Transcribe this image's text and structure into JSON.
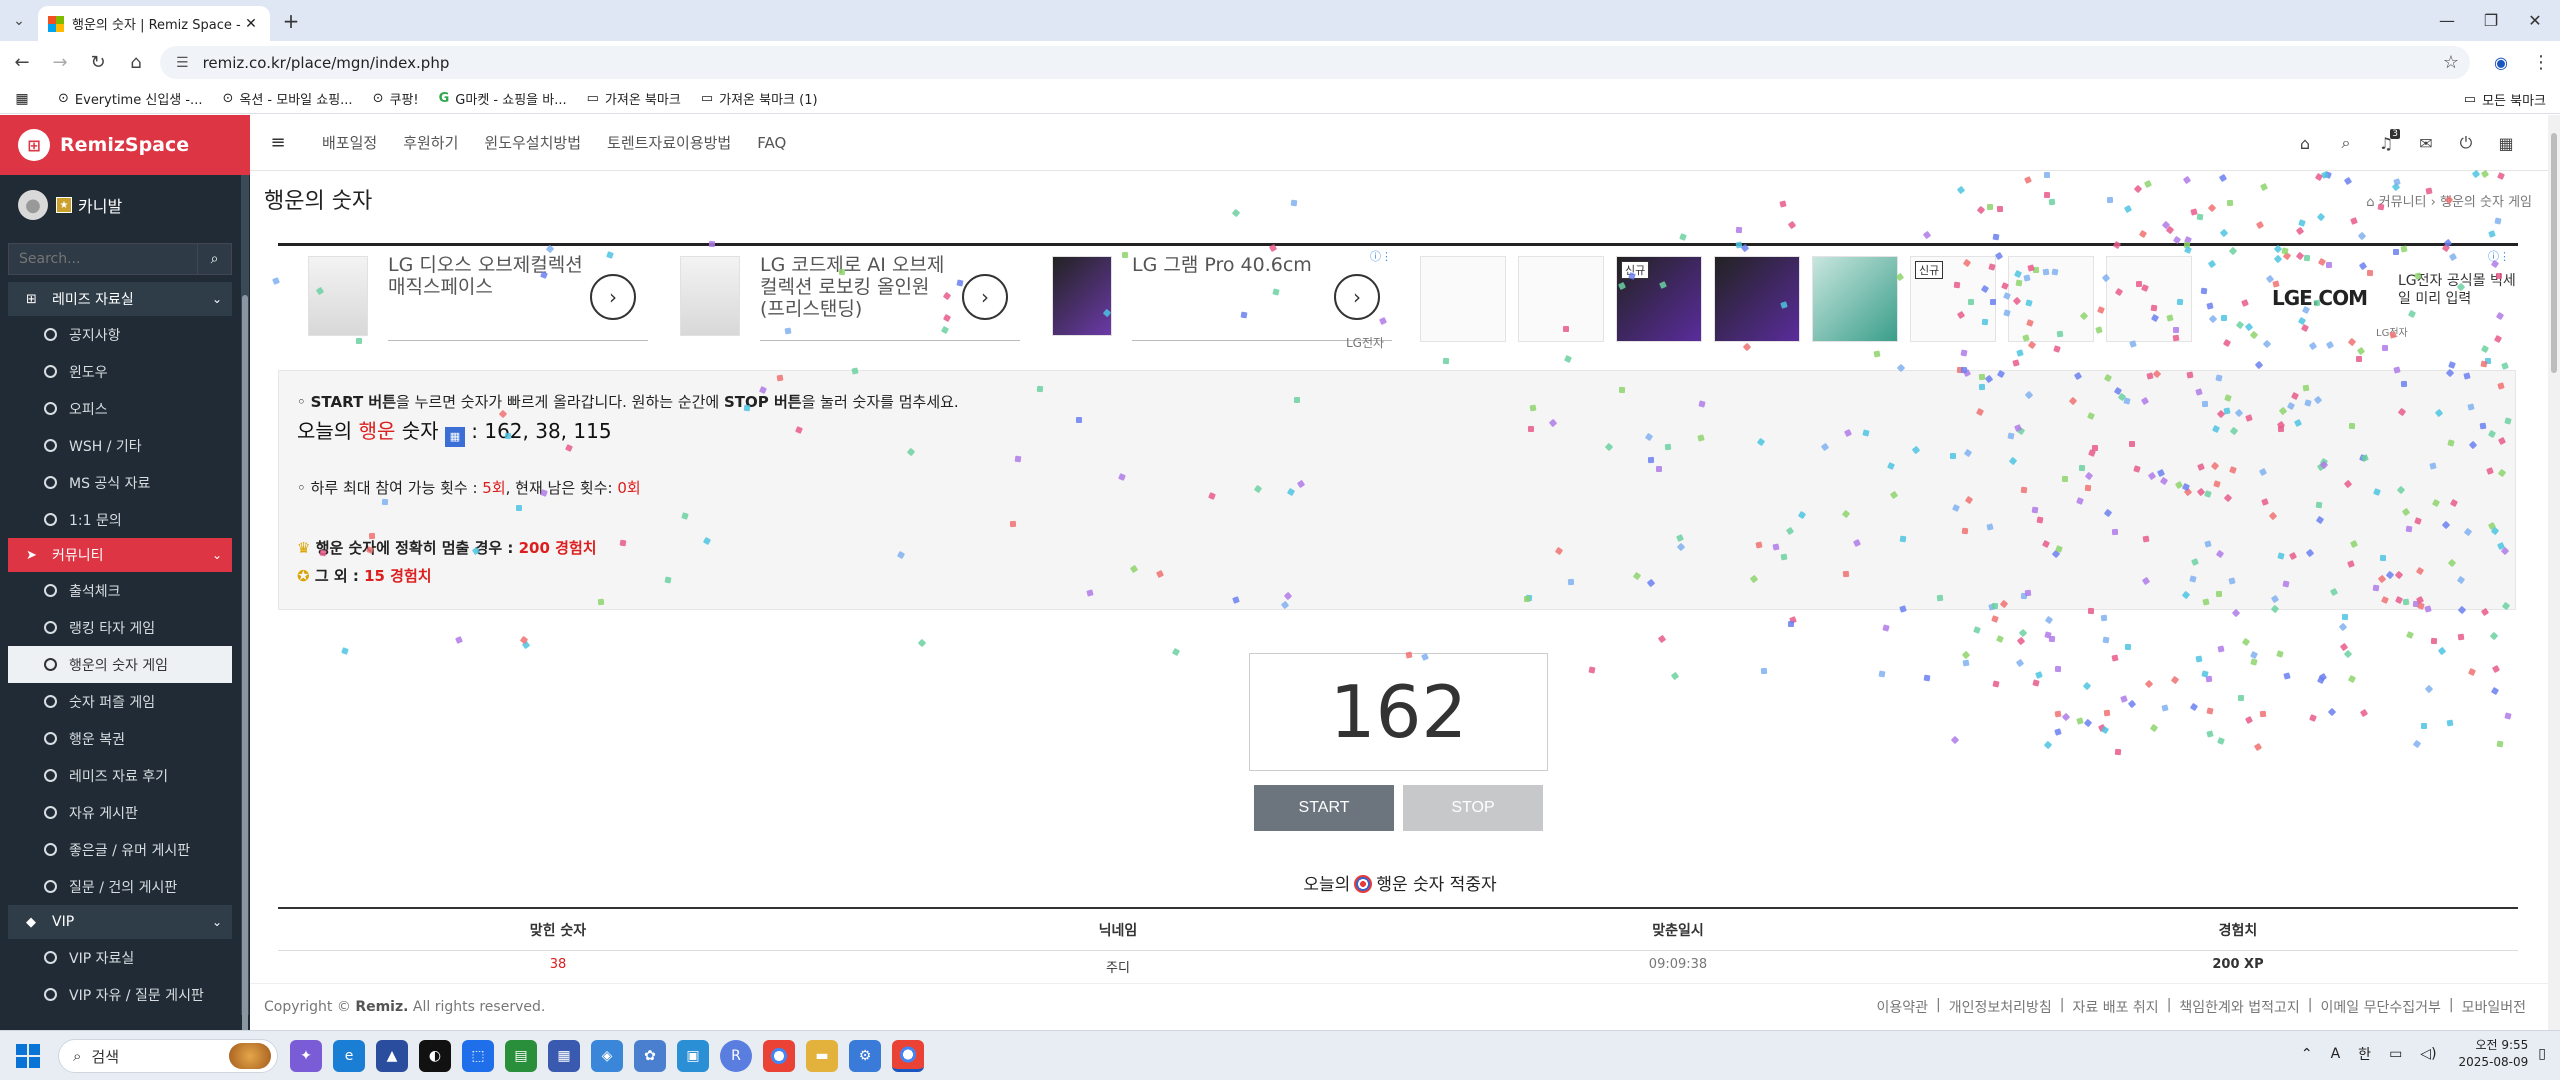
{
  "browser": {
    "tab_title": "행운의 숫자 | Remiz Space - 리",
    "url": "remiz.co.kr/place/mgn/index.php",
    "bookmarks": [
      "Everytime 신입생 -...",
      "옥션 - 모바일 쇼핑...",
      "쿠팡!",
      "G마켓 - 쇼핑을 바...",
      "가져온 북마크",
      "가져온 북마크 (1)"
    ],
    "all_bookmarks": "모든 북마크"
  },
  "sidebar": {
    "brand": "RemizSpace",
    "username": "카니발",
    "search_placeholder": "Search...",
    "sections": [
      {
        "label": "레미즈 자료실",
        "items": [
          "공지사항",
          "윈도우",
          "오피스",
          "WSH / 기타",
          "MS 공식 자료",
          "1:1 문의"
        ]
      },
      {
        "label": "커뮤니티",
        "items": [
          "출석체크",
          "랭킹 타자 게임",
          "행운의 숫자 게임",
          "숫자 퍼즐 게임",
          "행운 복권",
          "레미즈 자료 후기",
          "자유 게시판",
          "좋은글 / 유머 게시판",
          "질문 / 건의 게시판"
        ]
      },
      {
        "label": "VIP",
        "items": [
          "VIP 자료실",
          "VIP 자유 / 질문 게시판"
        ]
      }
    ]
  },
  "topnav": {
    "links": [
      "배포일정",
      "후원하기",
      "윈도우설치방법",
      "토렌트자료이용방법",
      "FAQ"
    ],
    "notif_count": "3"
  },
  "page": {
    "title": "행운의 숫자",
    "breadcrumb_1": "커뮤니티",
    "breadcrumb_2": "행운의 숫자 게임"
  },
  "ads": {
    "items": [
      {
        "title": "LG 디오스 오브제컬렉션 매직스페이스"
      },
      {
        "title": "LG 코드제로 AI 오브제컬렉션 로보킹 올인원 (프리스탠딩)"
      },
      {
        "title": "LG 그램 Pro 40.6cm"
      }
    ],
    "advertiser": "LG전자",
    "new_badge": "신규",
    "lge": "LGE.COM",
    "lge_text": "LG전자 공식몰 빅세일 미리 입력",
    "lge_small": "LG전자"
  },
  "game": {
    "instruction_pre": "◦ ",
    "instruction_b1": "START 버튼",
    "instruction_mid": "을 누르면 숫자가 빠르게 올라갑니다. 원하는 순간에 ",
    "instruction_b2": "STOP 버튼",
    "instruction_post": "을 눌러 숫자를 멈추세요.",
    "today_pre": "오늘의 ",
    "today_red": "행운",
    "today_post": " 숫자 ",
    "today_numbers": ": 162, 38, 115",
    "limit_pre": "◦ 하루 최대 참여 가능 횟수 : ",
    "limit_val": "5회",
    "remain_pre": ", 현재 남은 횟수: ",
    "remain_val": "0회",
    "reward1_pre": "행운 숫자에 정확히 멈출 경우 : ",
    "reward1_val": "200 경험치",
    "reward2_pre": "그 외 : ",
    "reward2_val": "15 경험치",
    "current": "162",
    "start": "START",
    "stop": "STOP",
    "winners_pre": "오늘의",
    "winners_post": "행운 숫자 적중자",
    "table_headers": [
      "맞힌 숫자",
      "닉네임",
      "맞춘일시",
      "경험치"
    ],
    "row": [
      "38",
      "주디",
      "09:09:38",
      "200 XP"
    ]
  },
  "footer": {
    "copy_pre": "Copyright © ",
    "copy_brand": "Remiz.",
    "copy_post": " All rights reserved.",
    "links": [
      "이용약관",
      "개인정보처리방침",
      "자료 배포 취지",
      "책임한계와 법적고지",
      "이메일 무단수집거부",
      "모바일버전"
    ]
  },
  "taskbar": {
    "search": "검색",
    "time": "오전 9:55",
    "date": "2025-08-09",
    "ime_a": "A",
    "ime_han": "한"
  }
}
